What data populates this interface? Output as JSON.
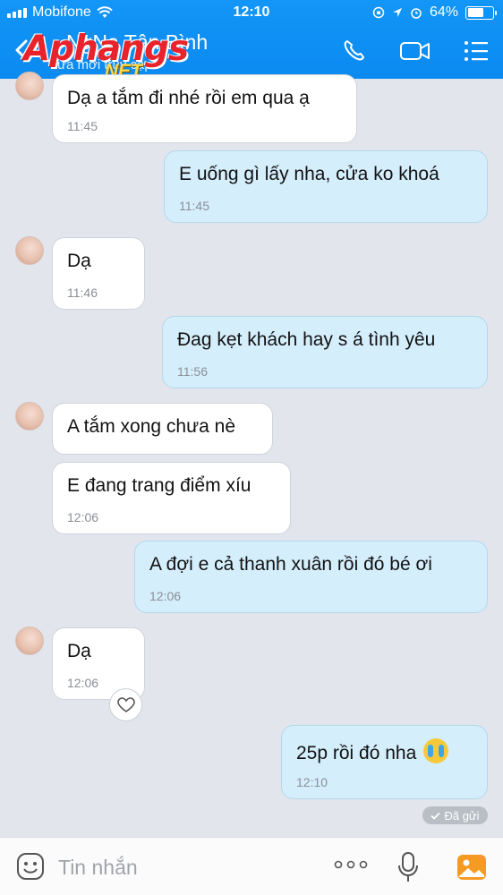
{
  "status_bar": {
    "carrier": "Mobifone",
    "time": "12:10",
    "battery": "64%",
    "battery_level": 0.64
  },
  "header": {
    "contact_name": "NgNa Tân Bình",
    "contact_status": "Vừa mới truy cập",
    "watermark": "Aphangs",
    "watermark_sub": ".NET",
    "icons": [
      "back-arrow-icon",
      "phone-icon",
      "video-call-icon",
      "menu-list-icon"
    ]
  },
  "messages": [
    {
      "dir": "in",
      "text": "Dạ a tắm đi nhé rồi em qua ạ",
      "time": "11:45"
    },
    {
      "dir": "out",
      "text": "E uống gì lấy nha, cửa ko khoá",
      "time": "11:45"
    },
    {
      "dir": "in",
      "text": "Dạ",
      "time": "11:46"
    },
    {
      "dir": "out",
      "text": "Đag kẹt khách hay s á tình yêu",
      "time": "11:56"
    },
    {
      "dir": "in",
      "text": "A tắm xong chưa nè",
      "time": ""
    },
    {
      "dir": "in",
      "text": "E đang trang điểm xíu",
      "time": "12:06"
    },
    {
      "dir": "out",
      "text": "A đợi e cả thanh xuân rồi đó bé ơi",
      "time": "12:06"
    },
    {
      "dir": "in",
      "text": "Dạ",
      "time": "12:06"
    },
    {
      "dir": "out",
      "text": "25p rồi đó nha",
      "time": "12:10"
    }
  ],
  "sent_status": "Đã gửi",
  "composer": {
    "placeholder": "Tin nhắn"
  },
  "colors": {
    "header": "#0b8af0",
    "outgoing_bubble": "#d5eefc",
    "incoming_bubble": "#ffffff",
    "background": "#e2e6ec"
  }
}
